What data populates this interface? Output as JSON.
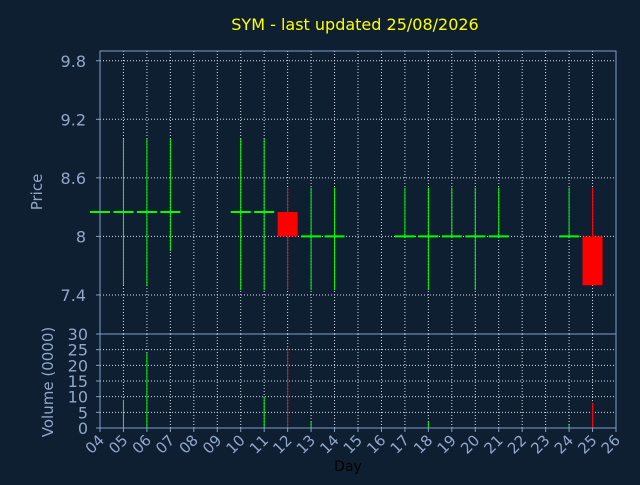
{
  "chart_data": [
    {
      "type": "candlestick",
      "title": "SYM - last updated 25/08/2026",
      "ylabel": "Price",
      "ylim": [
        7.0,
        9.9
      ],
      "yticks": [
        7.4,
        8,
        8.6,
        9.2,
        9.8
      ],
      "ytick_labels": [
        "7.4",
        "8",
        "8.6",
        "9.2",
        "9.8"
      ],
      "grid": true,
      "candles": [
        {
          "day": 4,
          "open": 8.25,
          "high": 8.25,
          "low": 8.25,
          "close": 8.25
        },
        {
          "day": 5,
          "open": 8.25,
          "high": 9.0,
          "low": 7.5,
          "close": 8.25
        },
        {
          "day": 6,
          "open": 8.25,
          "high": 9.0,
          "low": 7.5,
          "close": 8.25
        },
        {
          "day": 7,
          "open": 8.25,
          "high": 9.0,
          "low": 7.85,
          "close": 8.25
        },
        {
          "day": 10,
          "open": 8.25,
          "high": 9.0,
          "low": 7.45,
          "close": 8.25
        },
        {
          "day": 11,
          "open": 8.25,
          "high": 9.0,
          "low": 7.45,
          "close": 8.25
        },
        {
          "day": 12,
          "open": 8.25,
          "high": 8.5,
          "low": 7.45,
          "close": 8.0
        },
        {
          "day": 13,
          "open": 8.0,
          "high": 8.5,
          "low": 7.45,
          "close": 8.0
        },
        {
          "day": 14,
          "open": 8.0,
          "high": 8.5,
          "low": 7.45,
          "close": 8.0
        },
        {
          "day": 17,
          "open": 8.0,
          "high": 8.5,
          "low": 8.0,
          "close": 8.0
        },
        {
          "day": 18,
          "open": 8.0,
          "high": 8.5,
          "low": 7.45,
          "close": 8.0
        },
        {
          "day": 19,
          "open": 8.0,
          "high": 8.5,
          "low": 8.0,
          "close": 8.0
        },
        {
          "day": 20,
          "open": 8.0,
          "high": 8.5,
          "low": 7.45,
          "close": 8.0
        },
        {
          "day": 21,
          "open": 8.0,
          "high": 8.5,
          "low": 8.0,
          "close": 8.0
        },
        {
          "day": 24,
          "open": 8.0,
          "high": 8.5,
          "low": 8.0,
          "close": 8.0
        },
        {
          "day": 25,
          "open": 8.0,
          "high": 8.5,
          "low": 7.5,
          "close": 7.5
        }
      ],
      "colors": {
        "up": "#00ff00",
        "down": "#ff0000"
      }
    },
    {
      "type": "bar",
      "ylabel": "Volume (0000)",
      "xlabel": "Day",
      "ylim": [
        0,
        30
      ],
      "yticks": [
        0,
        5,
        10,
        15,
        20,
        25,
        30
      ],
      "ytick_labels": [
        "0",
        "5",
        "10",
        "15",
        "20",
        "25",
        "30"
      ],
      "xlim": [
        4,
        26
      ],
      "x_tick_labels": [
        "04",
        "05",
        "06",
        "07",
        "08",
        "09",
        "10",
        "11",
        "12",
        "13",
        "14",
        "15",
        "16",
        "17",
        "18",
        "19",
        "20",
        "21",
        "22",
        "23",
        "24",
        "25",
        "26"
      ],
      "grid": true,
      "bars": [
        {
          "day": 5,
          "value": 9,
          "color": "#00ff00"
        },
        {
          "day": 6,
          "value": 24,
          "color": "#00ff00"
        },
        {
          "day": 11,
          "value": 10,
          "color": "#00ff00"
        },
        {
          "day": 12,
          "value": 26,
          "color": "#ff0000"
        },
        {
          "day": 13,
          "value": 2,
          "color": "#00ff00"
        },
        {
          "day": 18,
          "value": 2,
          "color": "#00ff00"
        },
        {
          "day": 24,
          "value": 1,
          "color": "#00ff00"
        },
        {
          "day": 25,
          "value": 8,
          "color": "#ff0000"
        }
      ]
    }
  ],
  "colors": {
    "background": "#0f1f32",
    "frame": "#7f9fc8",
    "grid": "#d8dde6",
    "title": "#ffff00",
    "label": "#8fa8c8",
    "xlabel": "#000000"
  }
}
